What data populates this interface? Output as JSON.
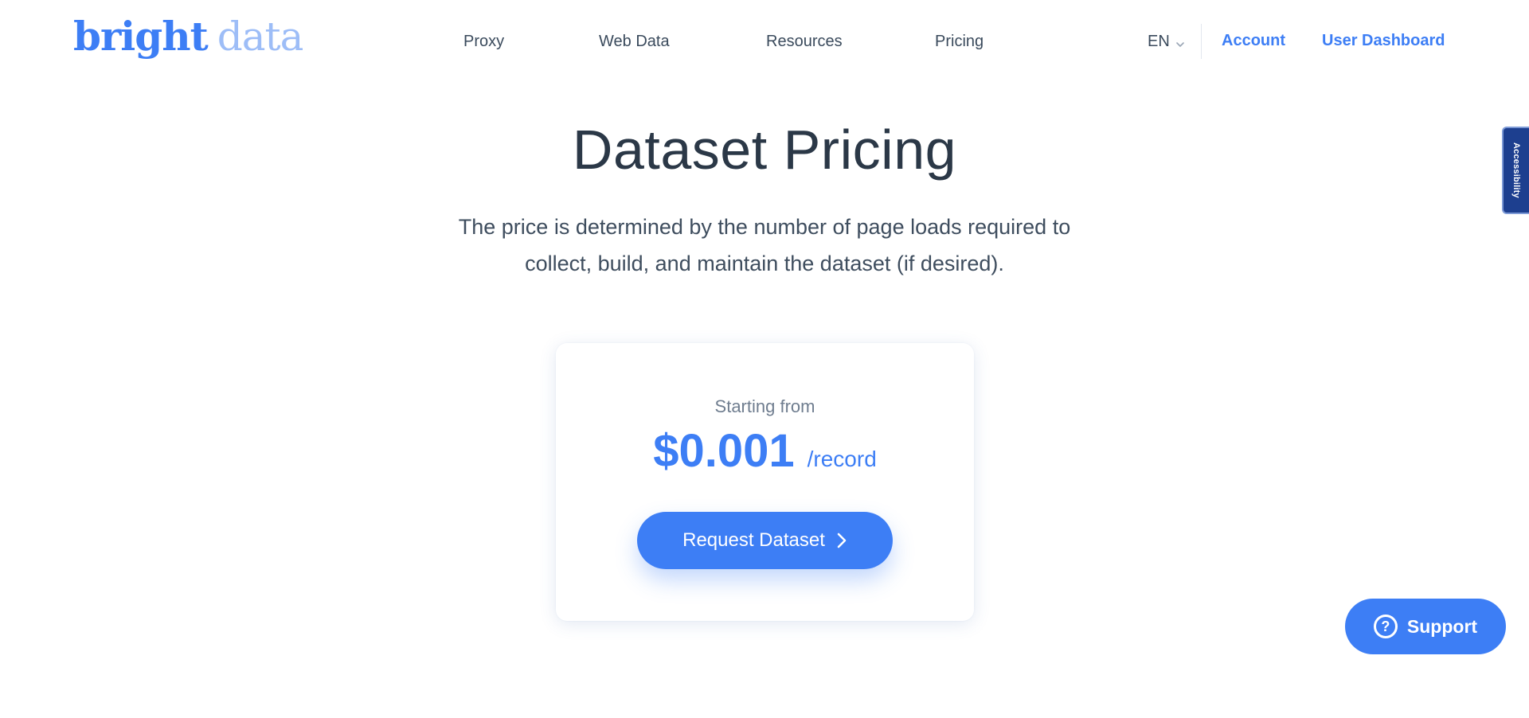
{
  "header": {
    "logo": {
      "word1": "bright",
      "word2": "data"
    },
    "nav": [
      {
        "label": "Proxy"
      },
      {
        "label": "Web Data"
      },
      {
        "label": "Resources"
      },
      {
        "label": "Pricing"
      }
    ],
    "language": "EN",
    "account_label": "Account",
    "dashboard_label": "User Dashboard"
  },
  "accessibility_tab": {
    "label": "Accessibility"
  },
  "hero": {
    "title": "Dataset Pricing",
    "subtitle_line1": "The price is determined by the number of page loads required to",
    "subtitle_line2": "collect, build, and maintain the dataset (if desired)."
  },
  "pricing_card": {
    "starting_label": "Starting from",
    "price": "$0.001",
    "unit": "/record",
    "cta_label": "Request Dataset"
  },
  "support": {
    "label": "Support",
    "icon_glyph": "?"
  },
  "colors": {
    "brand": "#3d7ef5",
    "brand_light": "#9dbdf7",
    "text_dark": "#2b3847",
    "accessibility_bg": "#1d3f8f"
  },
  "icons": {
    "language": "chevron-down-icon",
    "cta": "chevron-right-icon",
    "support": "question-circle-icon"
  }
}
